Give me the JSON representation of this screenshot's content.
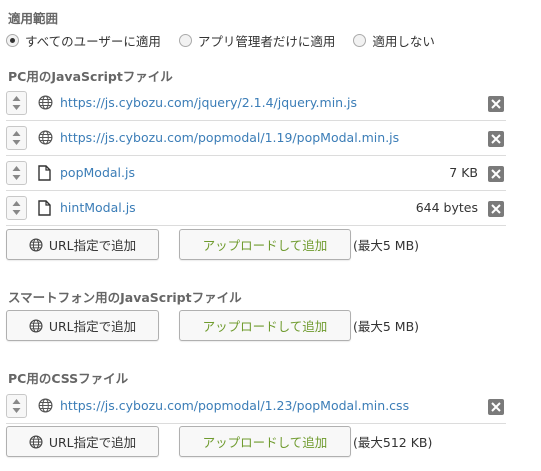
{
  "scope": {
    "title": "適用範囲",
    "options": [
      {
        "label": "すべてのユーザーに適用",
        "checked": true
      },
      {
        "label": "アプリ管理者だけに適用",
        "checked": false
      },
      {
        "label": "適用しない",
        "checked": false
      }
    ]
  },
  "pc_js": {
    "title": "PC用のJavaScriptファイル",
    "files": [
      {
        "type": "url",
        "name": "https://js.cybozu.com/jquery/2.1.4/jquery.min.js",
        "size": ""
      },
      {
        "type": "url",
        "name": "https://js.cybozu.com/popmodal/1.19/popModal.min.js",
        "size": ""
      },
      {
        "type": "file",
        "name": "popModal.js",
        "size": "7 KB"
      },
      {
        "type": "file",
        "name": "hintModal.js",
        "size": "644 bytes"
      }
    ],
    "url_button": "URL指定で追加",
    "upload_button": "アップロードして追加",
    "max_note": "(最大5 MB)"
  },
  "mobile_js": {
    "title": "スマートフォン用のJavaScriptファイル",
    "url_button": "URL指定で追加",
    "upload_button": "アップロードして追加",
    "max_note": "(最大5 MB)"
  },
  "pc_css": {
    "title": "PC用のCSSファイル",
    "files": [
      {
        "type": "url",
        "name": "https://js.cybozu.com/popmodal/1.23/popModal.min.css",
        "size": ""
      }
    ],
    "url_button": "URL指定で追加",
    "upload_button": "アップロードして追加",
    "max_note": "(最大512 KB)"
  },
  "colors": {
    "link": "#3b7db7",
    "upload_text": "#6f9b2e",
    "delete_bg": "#7a7a7a"
  }
}
